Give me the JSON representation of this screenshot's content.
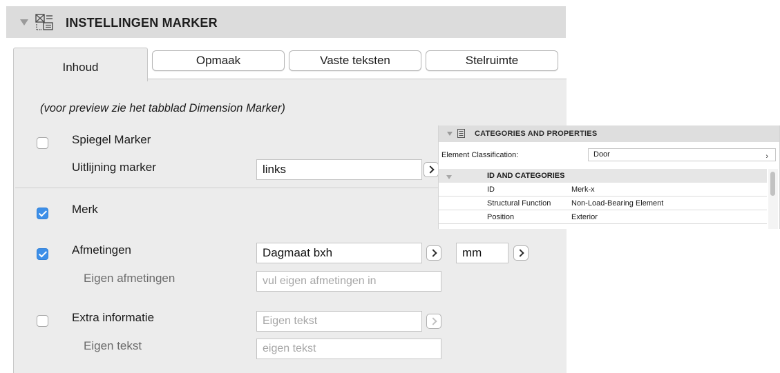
{
  "main_panel": {
    "title": "INSTELLINGEN MARKER",
    "tabs": {
      "inhoud": "Inhoud",
      "opmaak": "Opmaak",
      "vaste_teksten": "Vaste teksten",
      "stelruimte": "Stelruimte"
    },
    "preview_note": "(voor preview zie het tabblad Dimension Marker)",
    "spiegel_marker": {
      "label": "Spiegel Marker",
      "checked": false
    },
    "uitlijning_marker": {
      "label": "Uitlijning marker",
      "value": "links"
    },
    "merk": {
      "label": "Merk",
      "checked": true
    },
    "afmetingen": {
      "label": "Afmetingen",
      "checked": true,
      "value": "Dagmaat bxh",
      "unit": "mm"
    },
    "eigen_afmetingen": {
      "label": "Eigen afmetingen",
      "placeholder": "vul eigen afmetingen in"
    },
    "extra_informatie": {
      "label": "Extra informatie",
      "checked": false,
      "value": "Eigen tekst"
    },
    "eigen_tekst": {
      "label": "Eigen tekst",
      "placeholder": "eigen tekst"
    },
    "colors": {
      "checkbox_checked": "#3d8fe8",
      "header_bg": "#dcdcdc",
      "content_bg": "#ececec"
    },
    "icons": {
      "header_icon": "marker-settings-icon",
      "disclosure": "triangle-down-icon",
      "selector": "chevron-right-icon"
    }
  },
  "overlay_panel": {
    "title": "CATEGORIES AND PROPERTIES",
    "element_classification_label": "Element Classification:",
    "element_classification_value": "Door",
    "section_title": "ID AND CATEGORIES",
    "rows": [
      {
        "name": "ID",
        "value": "Merk-x"
      },
      {
        "name": "Structural Function",
        "value": "Non-Load-Bearing Element"
      },
      {
        "name": "Position",
        "value": "Exterior"
      }
    ],
    "icons": {
      "header_icon": "document-list-icon"
    }
  }
}
